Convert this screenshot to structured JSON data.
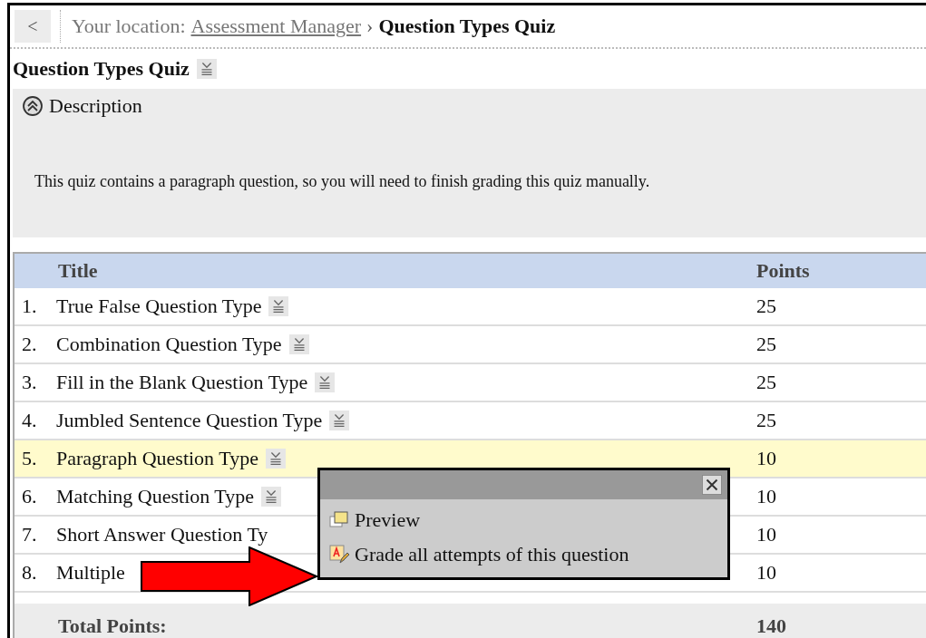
{
  "breadcrumb": {
    "back": "<",
    "label": "Your location:",
    "link": "Assessment Manager",
    "separator": "›",
    "current": "Question Types Quiz"
  },
  "title": "Question Types Quiz",
  "description": {
    "heading": "Description",
    "expanded": true,
    "text": "This quiz contains a paragraph question, so you will need to finish grading this quiz manually."
  },
  "table": {
    "columns": [
      "Title",
      "Points"
    ],
    "rows": [
      {
        "number": "1.",
        "title": "True False Question Type",
        "points": "25",
        "selected": false,
        "menu_icon": true
      },
      {
        "number": "2.",
        "title": "Combination Question Type",
        "points": "25",
        "selected": false,
        "menu_icon": true
      },
      {
        "number": "3.",
        "title": "Fill in the Blank Question Type",
        "points": "25",
        "selected": false,
        "menu_icon": true
      },
      {
        "number": "4.",
        "title": "Jumbled Sentence Question Type",
        "points": "25",
        "selected": false,
        "menu_icon": true
      },
      {
        "number": "5.",
        "title": "Paragraph Question Type",
        "points": "10",
        "selected": true,
        "menu_icon": true
      },
      {
        "number": "6.",
        "title": "Matching Question Type",
        "points": "10",
        "selected": false,
        "menu_icon": true
      },
      {
        "number": "7.",
        "title": "Short Answer Question Ty",
        "points": "10",
        "selected": false,
        "menu_icon": false
      },
      {
        "number": "8.",
        "title": "Multiple",
        "points": "10",
        "selected": false,
        "menu_icon": false
      }
    ],
    "total_label": "Total Points:",
    "total": "140"
  },
  "popup_menu": {
    "items": [
      {
        "kind": "preview",
        "label": "Preview"
      },
      {
        "kind": "grade",
        "label": "Grade all attempts of this question"
      }
    ]
  }
}
